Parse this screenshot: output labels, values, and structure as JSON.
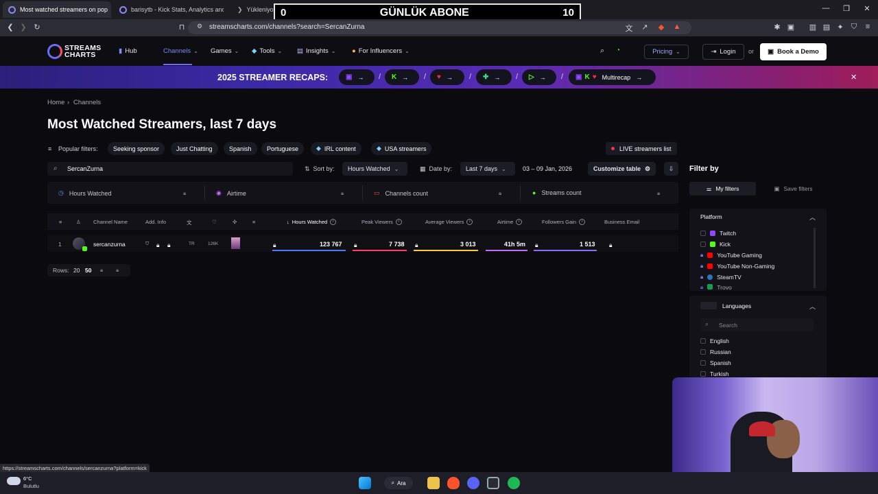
{
  "browser": {
    "tabs": [
      {
        "label": "Most watched streamers on pop"
      },
      {
        "label": "barisytb - Kick Stats, Analytics and Cl"
      },
      {
        "label": "Yükleniyor..."
      }
    ],
    "url": "streamscharts.com/channels?search=SercanZurna"
  },
  "overlay": {
    "left": "0",
    "title": "GÜNLÜK ABONE",
    "right": "10"
  },
  "nav": {
    "logo_line1": "STREAMS",
    "logo_line2": "CHARTS",
    "items": [
      {
        "label": "Hub"
      },
      {
        "label": "Channels"
      },
      {
        "label": "Games"
      },
      {
        "label": "Tools"
      },
      {
        "label": "Insights"
      },
      {
        "label": "For Influencers"
      }
    ],
    "pricing": "Pricing",
    "login": "Login",
    "or": "or",
    "demo": "Book a Demo"
  },
  "banner": {
    "title": "2025 STREAMER RECAPS:",
    "multicap": "Multirecap"
  },
  "breadcrumb": {
    "home": "Home",
    "channels": "Channels"
  },
  "page_title": "Most Watched Streamers, last 7 days",
  "popular_filters": {
    "label": "Popular filters:",
    "chips": [
      "Seeking sponsor",
      "Just Chatting",
      "Spanish",
      "Portuguese",
      "IRL content",
      "USA streamers"
    ],
    "live": "LIVE streamers list"
  },
  "search": {
    "value": "SercanZurna"
  },
  "controls": {
    "sort_label": "Sort by:",
    "sort_value": "Hours Watched",
    "date_label": "Date by:",
    "date_value": "Last 7 days",
    "date_range": "03 – 09 Jan, 2026",
    "customize": "Customize table"
  },
  "metrics": [
    "Hours Watched",
    "Airtime",
    "Channels count",
    "Streams count"
  ],
  "table": {
    "headers": {
      "channel": "Channel Name",
      "add_info": "Add. Info",
      "hours": "Hours Watched",
      "peak": "Peak Viewers",
      "avg": "Average Viewers",
      "airtime": "Airtime",
      "followers": "Followers Gain",
      "email": "Business Email"
    },
    "row": {
      "rank": "1",
      "name": "sercanzurna",
      "lang": "TR",
      "followers_total": "126K",
      "hours": "123 767",
      "peak": "7 738",
      "avg": "3 013",
      "airtime": "41h 5m",
      "followers_gain": "1 513"
    }
  },
  "rows": {
    "label": "Rows:",
    "opt1": "20",
    "opt2": "50"
  },
  "filters": {
    "title": "Filter by",
    "my_filters": "My filters",
    "save_filters": "Save filters",
    "platform": {
      "title": "Platform",
      "options": [
        "Twitch",
        "Kick",
        "YouTube Gaming",
        "YouTube Non-Gaming",
        "SteamTV",
        "Trovo"
      ]
    },
    "languages": {
      "title": "Languages",
      "search_placeholder": "Search",
      "options": [
        "English",
        "Russian",
        "Spanish",
        "Turkish"
      ]
    }
  },
  "status_url": "https://streamscharts.com/channels/sercanzurna?platform=kick",
  "taskbar": {
    "temp": "6°C",
    "weather": "Bulutlu",
    "search": "Ara"
  },
  "colors": {
    "accent": "#6b6bff",
    "kick": "#53fc18",
    "twitch": "#9146ff",
    "youtube": "#ff0000",
    "live": "#ff2d55"
  }
}
